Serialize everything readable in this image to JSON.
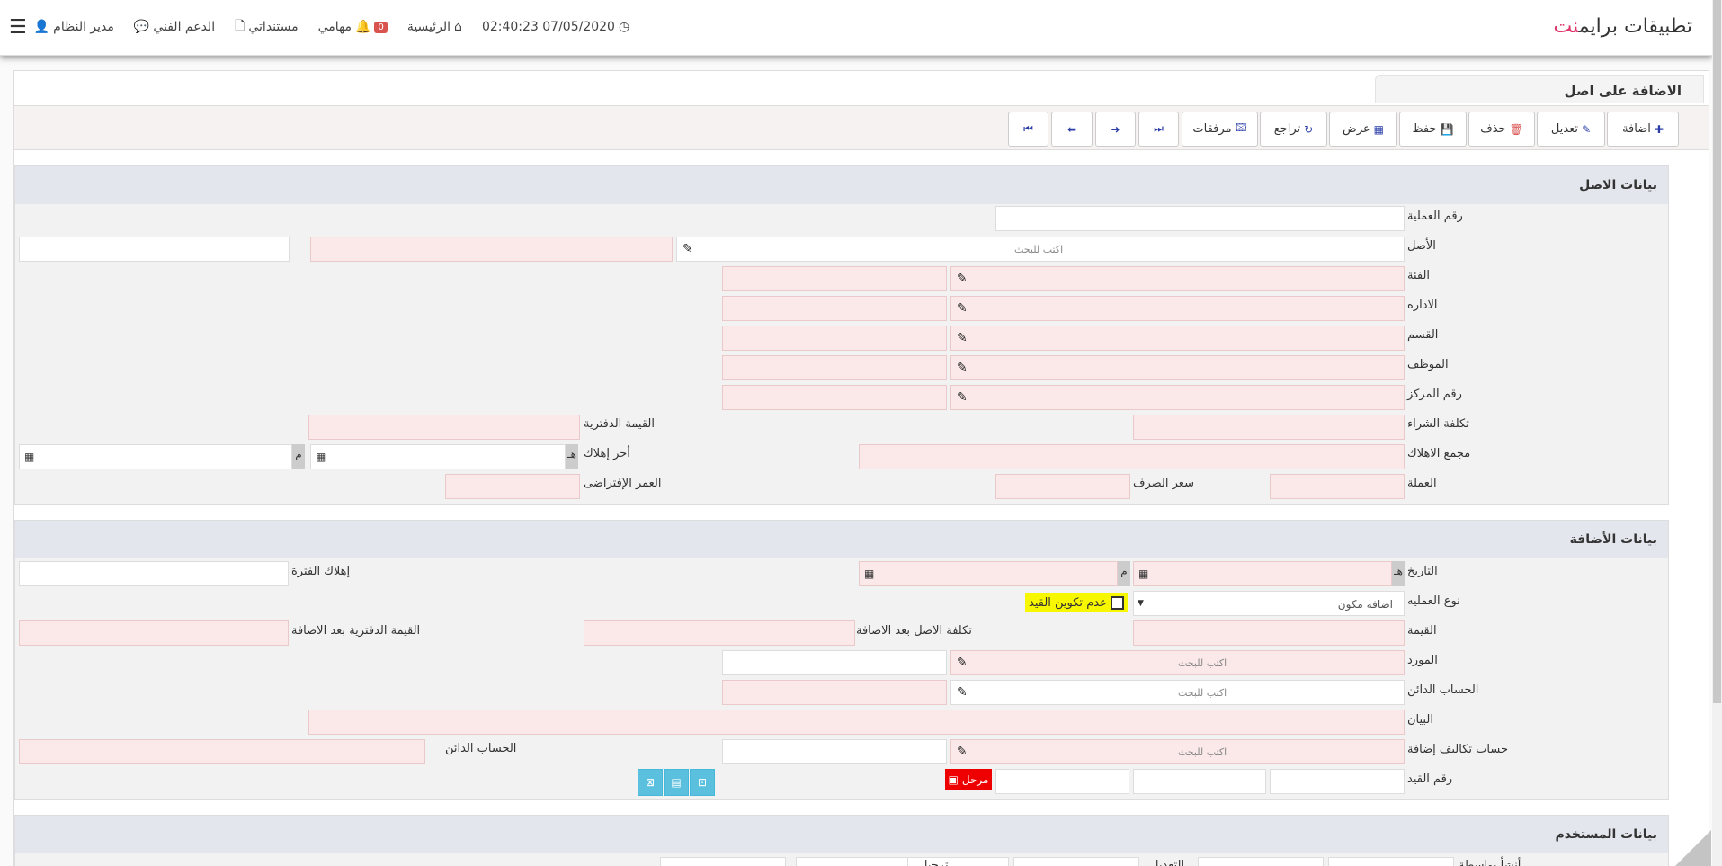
{
  "brand": {
    "main": "تطبيقات برايم",
    "accent": "نت"
  },
  "topnav": {
    "user": "مدير النظام",
    "support": "الدعم الفني",
    "docs": "مستنداتي",
    "tasks": "مهامي",
    "notif_count": "0",
    "home": "الرئيسية",
    "datetime": "02:40:23 07/05/2020"
  },
  "page": {
    "title": "الاضافة على اصل"
  },
  "toolbar": {
    "add": "اضافة",
    "edit": "تعديل",
    "delete": "حذف",
    "save": "حفظ",
    "view": "عرض",
    "undo": "تراجع",
    "attachments": "مرفقات",
    "first": "⏮",
    "prev": "→",
    "next": "←",
    "last": "⏭"
  },
  "asset_section": {
    "title": "بيانات الاصل",
    "op_number": "رقم العملية",
    "asset": "الأصل",
    "search_ph": "اكتب للبحث",
    "category": "الفئة",
    "department": "الاداره",
    "section": "القسم",
    "employee": "الموظف",
    "center_no": "رقم المركز",
    "purchase_cost": "تكلفة الشراء",
    "book_value": "القيمة الدفترية",
    "accum_dep": "مجمع الاهلاك",
    "last_dep": "أخر إهلاك",
    "hijri_marker": "هـ",
    "greg_marker": "م",
    "currency": "العملة",
    "exchange_rate": "سعر الصرف",
    "default_life": "العمر الإفتراضى"
  },
  "addition_section": {
    "title": "بيانات الأضافة",
    "date": "التاريخ",
    "period_dep": "إهلاك الفترة",
    "op_type": "نوع العمليه",
    "op_type_value": "اضافة مكون",
    "no_entry": "عدم تكوين القيد",
    "value": "القيمة",
    "cost_after": "تكلفة الاصل بعد الاضافة",
    "book_after": "القيمة الدفترية بعد الاضافة",
    "supplier": "المورد",
    "credit_account": "الحساب الدائن",
    "statement": "البيان",
    "extra_cost_account": "حساب تكاليف إضافة",
    "credit_account2": "الحساب الدائن",
    "entry_no": "رقم القيد",
    "posted": "مرحل"
  },
  "user_section": {
    "title": "بيانات المستخدم",
    "created_by": "أنشأ بواسطة",
    "modified": "التعديل",
    "posted": "ترحيل"
  }
}
